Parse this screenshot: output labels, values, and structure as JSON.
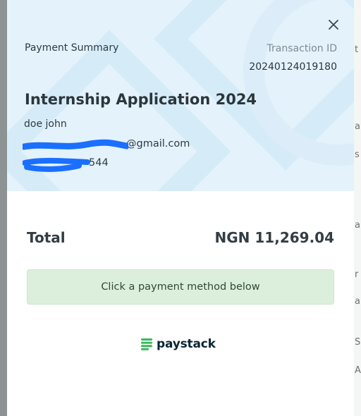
{
  "modal": {
    "summary_title": "Payment Summary",
    "transaction": {
      "label": "Transaction ID",
      "id": "20240124019180"
    },
    "product_title": "Internship Application 2024",
    "customer": {
      "name": "doe john",
      "email_visible": "@gmail.com",
      "phone_visible": "544"
    },
    "total": {
      "label": "Total",
      "amount": "NGN 11,269.04"
    },
    "notice": "Click a payment method below",
    "provider": {
      "name": "paystack",
      "logo_icon": "paystack-logo-icon",
      "logo_color": "#3bb75e"
    },
    "close_icon": "close-icon"
  },
  "colors": {
    "header_bg": "#e4f2fb",
    "notice_bg": "#dcefdc",
    "redaction": "#1a6fff"
  },
  "backdrop": {
    "glyphs": [
      "t",
      "a",
      "s",
      "a",
      "r",
      "a",
      "S",
      "A"
    ]
  }
}
